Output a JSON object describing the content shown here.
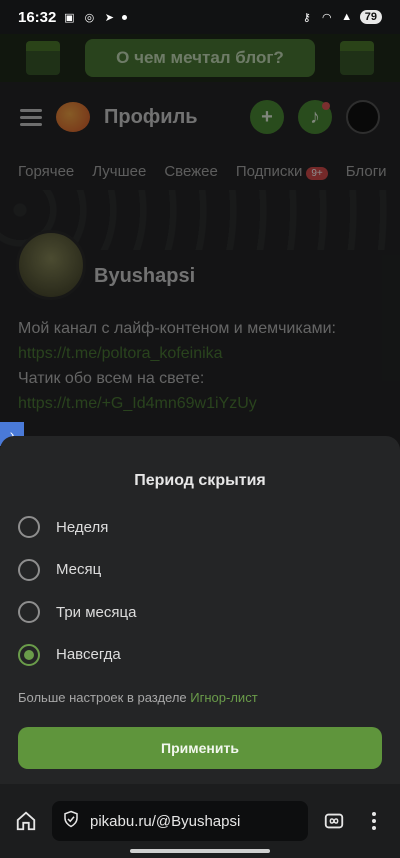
{
  "status_bar": {
    "time": "16:32",
    "battery": "79"
  },
  "banner": {
    "text": "О чем мечтал блог?"
  },
  "header": {
    "title": "Профиль",
    "add_label": "+"
  },
  "tabs": [
    {
      "label": "Горячее"
    },
    {
      "label": "Лучшее"
    },
    {
      "label": "Свежее"
    },
    {
      "label": "Подписки",
      "badge": "9+"
    },
    {
      "label": "Блоги"
    }
  ],
  "profile": {
    "name": "Byushapsi",
    "bio_line1": "Мой канал с лайф-контеном и мемчиками:",
    "bio_link1": "https://t.me/poltora_kofeinika",
    "bio_line2": "Чатик обо всем на свете:",
    "bio_link2": "https://t.me/+G_Id4mn69w1iYzUy"
  },
  "sheet": {
    "title": "Период скрытия",
    "options": [
      {
        "label": "Неделя",
        "selected": false
      },
      {
        "label": "Месяц",
        "selected": false
      },
      {
        "label": "Три месяца",
        "selected": false
      },
      {
        "label": "Навсегда",
        "selected": true
      }
    ],
    "more_prefix": "Больше настроек в разделе",
    "more_link": "Игнор-лист",
    "apply_label": "Применить"
  },
  "browser": {
    "url": "pikabu.ru/@Byushapsi"
  },
  "colors": {
    "accent": "#5f953c",
    "link": "#6a9c4a",
    "badge": "#d34b4b"
  }
}
